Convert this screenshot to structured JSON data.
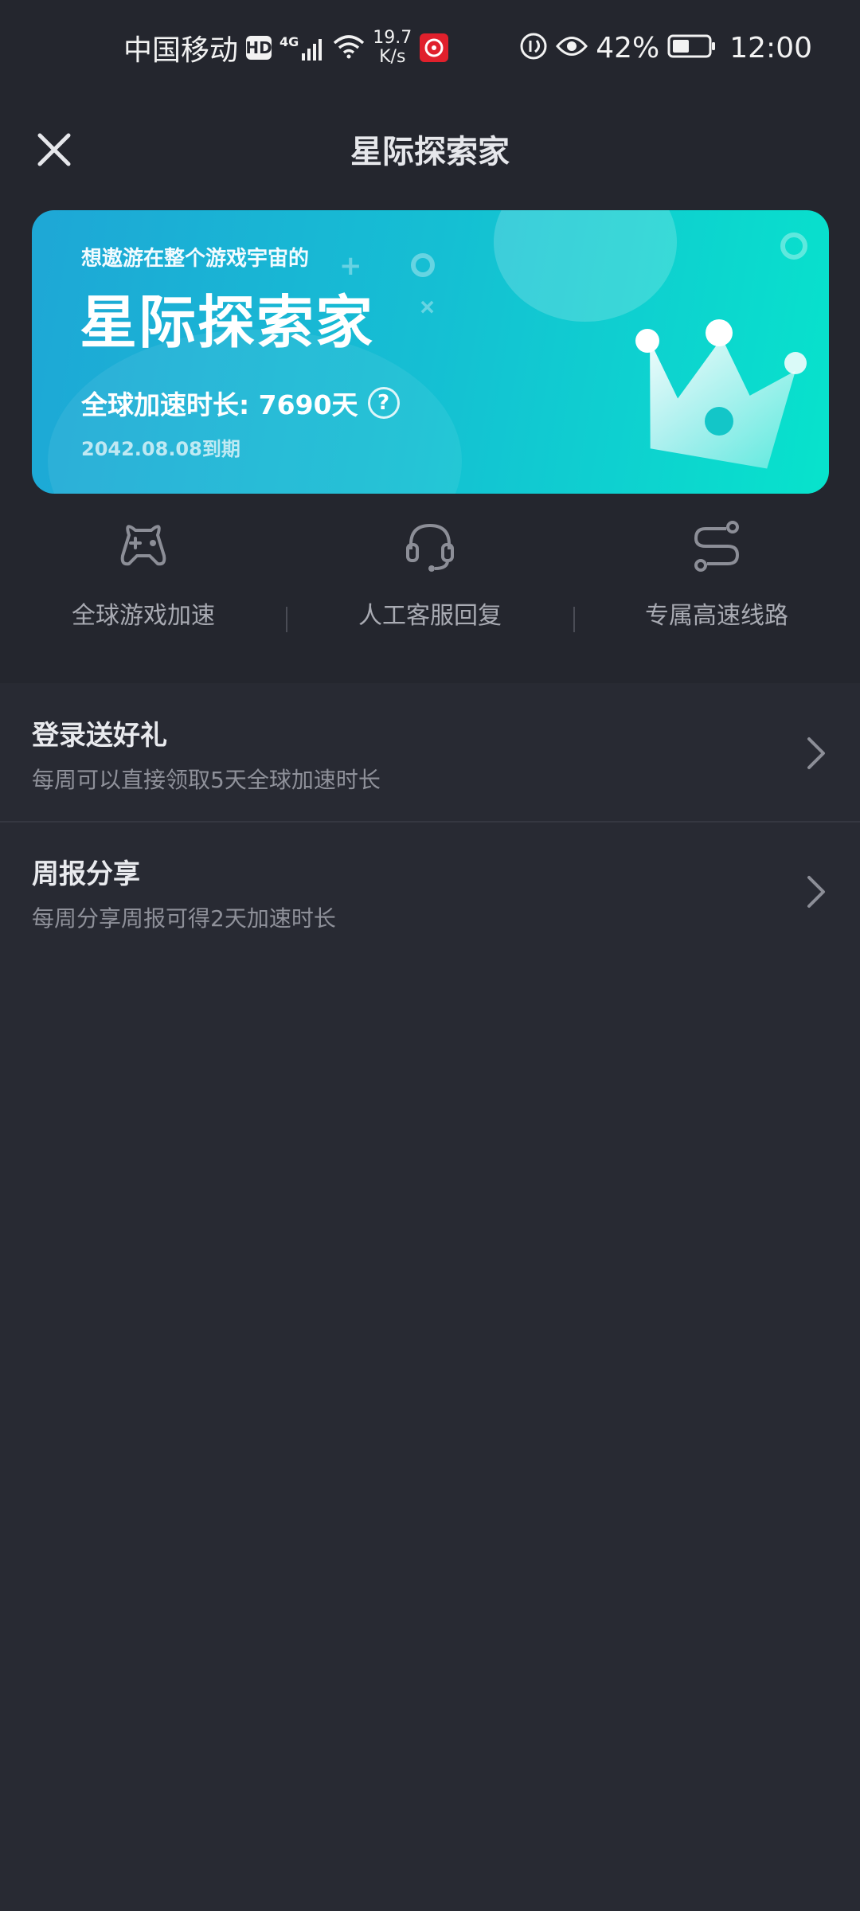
{
  "status_bar": {
    "carrier": "中国移动",
    "hd_badge": "HD",
    "network_type": "4G",
    "speed_value": "19.7",
    "speed_unit": "K/s",
    "battery_percent": "42%",
    "time": "12:00"
  },
  "header": {
    "title": "星际探索家",
    "close_icon": "close-icon"
  },
  "banner": {
    "subtitle": "想遨游在整个游戏宇宙的",
    "title": "星际探索家",
    "duration_label": "全球加速时长: 7690天",
    "expiry": "2042.08.08到期",
    "help_icon": "question-icon",
    "decoration_icon": "crown-icon",
    "colors": {
      "gradient_start": "#1ea7d6",
      "gradient_end": "#07e3cc"
    }
  },
  "features": [
    {
      "icon": "gamepad-icon",
      "label": "全球游戏加速"
    },
    {
      "icon": "headset-icon",
      "label": "人工客服回复"
    },
    {
      "icon": "route-icon",
      "label": "专属高速线路"
    }
  ],
  "list": [
    {
      "title": "登录送好礼",
      "desc": "每周可以直接领取5天全球加速时长"
    },
    {
      "title": "周报分享",
      "desc": "每周分享周报可得2天加速时长"
    }
  ]
}
